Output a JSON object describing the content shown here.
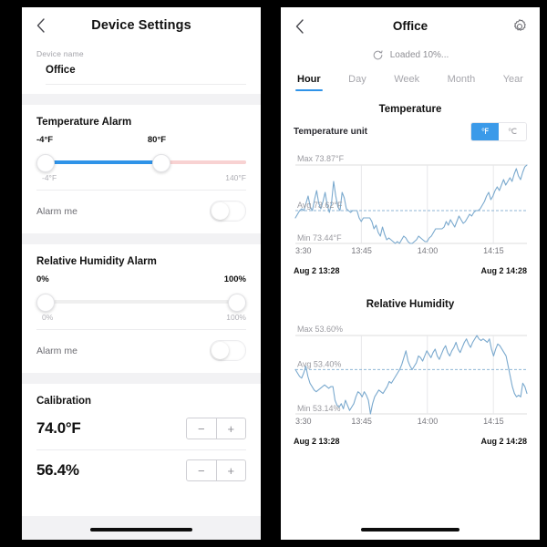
{
  "left_panel": {
    "navbar": {
      "title": "Device Settings",
      "back_icon": "chevron-left-icon"
    },
    "device_name": {
      "label": "Device name",
      "value": "Office"
    },
    "temperature_alarm": {
      "title": "Temperature Alarm",
      "low_value": "-4°F",
      "high_value": "80°F",
      "range_min": "-4°F",
      "range_max": "140°F",
      "alarm_label": "Alarm me",
      "alarm_enabled": false,
      "fill_color": "#2f93e8",
      "rest_color": "#f8d2d2"
    },
    "humidity_alarm": {
      "title": "Relative Humidity Alarm",
      "low_value": "0%",
      "high_value": "100%",
      "range_min": "0%",
      "range_max": "100%",
      "alarm_label": "Alarm me",
      "alarm_enabled": false
    },
    "calibration": {
      "title": "Calibration",
      "rows": [
        {
          "value": "74.0°F",
          "minus": "−",
          "plus": "+"
        },
        {
          "value": "56.4%",
          "minus": "−",
          "plus": "+"
        }
      ]
    }
  },
  "right_panel": {
    "navbar": {
      "title": "Office",
      "back_icon": "chevron-left-icon",
      "settings_icon": "gear-icon"
    },
    "loading": {
      "icon": "refresh-icon",
      "text": "Loaded 10%..."
    },
    "tabs": [
      {
        "label": "Hour",
        "active": true
      },
      {
        "label": "Day",
        "active": false
      },
      {
        "label": "Week",
        "active": false
      },
      {
        "label": "Month",
        "active": false
      },
      {
        "label": "Year",
        "active": false
      }
    ],
    "temperature_section": {
      "title": "Temperature",
      "unit_label": "Temperature unit",
      "unit_options": [
        {
          "label": "℉",
          "selected": true
        },
        {
          "label": "℃",
          "selected": false
        }
      ]
    },
    "humidity_section": {
      "title": "Relative Humidity"
    }
  },
  "chart_data": [
    {
      "type": "line",
      "title": "Temperature",
      "unit": "°F",
      "max_label": "Max 73.87°F",
      "avg_label": "Avg 73.62°F",
      "min_label": "Min 73.44°F",
      "max": 73.87,
      "avg": 73.62,
      "min": 73.44,
      "ylim": [
        73.44,
        73.87
      ],
      "grid": true,
      "legend": "none",
      "xlabel": "",
      "ylabel": "°F",
      "tick_labels": [
        "3:30",
        "13:45",
        "14:00",
        "14:15"
      ],
      "tick_positions": [
        0.0,
        0.285,
        0.57,
        0.855
      ],
      "range_start": "Aug 2  13:28",
      "range_end": "Aug 2  14:28",
      "line_color": "#7aa9ce",
      "values": [
        73.58,
        73.6,
        73.62,
        73.63,
        73.62,
        73.66,
        73.7,
        73.64,
        73.62,
        73.68,
        73.73,
        73.66,
        73.63,
        73.67,
        73.72,
        73.65,
        73.61,
        73.66,
        73.78,
        73.7,
        73.64,
        73.62,
        73.72,
        73.69,
        73.63,
        73.62,
        73.61,
        73.62,
        73.62,
        73.62,
        73.58,
        73.56,
        73.58,
        73.58,
        73.58,
        73.58,
        73.56,
        73.52,
        73.54,
        73.5,
        73.48,
        73.53,
        73.49,
        73.46,
        73.47,
        73.46,
        73.45,
        73.44,
        73.45,
        73.44,
        73.46,
        73.48,
        73.47,
        73.45,
        73.44,
        73.44,
        73.45,
        73.46,
        73.48,
        73.47,
        73.46,
        73.45,
        73.45,
        73.47,
        73.48,
        73.5,
        73.52,
        73.52,
        73.52,
        73.52,
        73.53,
        73.56,
        73.54,
        73.57,
        73.55,
        73.53,
        73.56,
        73.59,
        73.57,
        73.55,
        73.56,
        73.58,
        73.6,
        73.59,
        73.61,
        73.62,
        73.62,
        73.63,
        73.65,
        73.67,
        73.7,
        73.72,
        73.68,
        73.7,
        73.73,
        73.75,
        73.73,
        73.76,
        73.79,
        73.76,
        73.78,
        73.8,
        73.78,
        73.82,
        73.85,
        73.81,
        73.79,
        73.83,
        73.86,
        73.87
      ]
    },
    {
      "type": "line",
      "title": "Relative Humidity",
      "unit": "%",
      "max_label": "Max 53.60%",
      "avg_label": "Avg 53.40%",
      "min_label": "Min 53.14%",
      "max": 53.6,
      "avg": 53.4,
      "min": 53.14,
      "ylim": [
        53.14,
        53.6
      ],
      "grid": true,
      "legend": "none",
      "xlabel": "",
      "ylabel": "%",
      "tick_labels": [
        "3:30",
        "13:45",
        "14:00",
        "14:15"
      ],
      "tick_positions": [
        0.0,
        0.285,
        0.57,
        0.855
      ],
      "range_start": "Aug 2  13:28",
      "range_end": "Aug 2  14:28",
      "line_color": "#7aa9ce",
      "values": [
        53.4,
        53.38,
        53.36,
        53.35,
        53.38,
        53.42,
        53.36,
        53.32,
        53.3,
        53.28,
        53.27,
        53.28,
        53.29,
        53.3,
        53.31,
        53.3,
        53.29,
        53.3,
        53.3,
        53.22,
        53.19,
        53.18,
        53.2,
        53.17,
        53.22,
        53.19,
        53.16,
        53.18,
        53.2,
        53.24,
        53.27,
        53.26,
        53.24,
        53.27,
        53.25,
        53.22,
        53.14,
        53.2,
        53.24,
        53.26,
        53.28,
        53.27,
        53.26,
        53.28,
        53.3,
        53.33,
        53.32,
        53.34,
        53.36,
        53.38,
        53.4,
        53.43,
        53.47,
        53.51,
        53.45,
        53.42,
        53.4,
        53.42,
        53.44,
        53.48,
        53.47,
        53.45,
        53.48,
        53.51,
        53.49,
        53.47,
        53.5,
        53.52,
        53.48,
        53.46,
        53.49,
        53.52,
        53.54,
        53.5,
        53.48,
        53.51,
        53.53,
        53.56,
        53.52,
        53.5,
        53.53,
        53.56,
        53.58,
        53.55,
        53.53,
        53.56,
        53.58,
        53.6,
        53.58,
        53.57,
        53.58,
        53.57,
        53.56,
        53.58,
        53.52,
        53.48,
        53.52,
        53.55,
        53.54,
        53.52,
        53.5,
        53.48,
        53.42,
        53.36,
        53.3,
        53.26,
        53.24,
        53.25,
        53.24,
        53.32,
        53.3,
        53.26
      ]
    }
  ]
}
